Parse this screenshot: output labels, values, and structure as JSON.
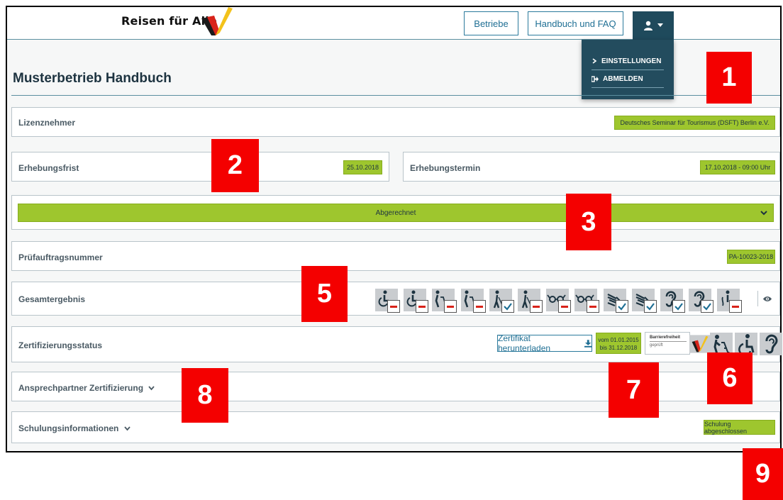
{
  "brand": {
    "name": "Reisen für Alle"
  },
  "nav": {
    "betriebe": "Betriebe",
    "handbuch": "Handbuch und FAQ"
  },
  "user_menu": {
    "items": [
      {
        "label": "EINSTELLUNGEN",
        "icon": "chevron-right-icon"
      },
      {
        "label": "ABMELDEN",
        "icon": "sign-out-icon"
      }
    ]
  },
  "page": {
    "title": "Musterbetrieb Handbuch"
  },
  "lizenznehmer": {
    "label": "Lizenznehmer",
    "value": "Deutsches Seminar für Tourismus (DSFT) Berlin e.V."
  },
  "erhebungsfrist": {
    "label": "Erhebungsfrist",
    "value": "25.10.2018"
  },
  "erhebungstermin": {
    "label": "Erhebungstermin",
    "value": "17.10.2018 - 09:00 Uhr"
  },
  "status": {
    "label": "Abgerechnet"
  },
  "pruefauftrag": {
    "label": "Prüfauftragsnummer",
    "value": "PA-10023-2018"
  },
  "gesamtergebnis": {
    "label": "Gesamtergebnis",
    "icons": [
      {
        "name": "wheelchair-icon",
        "result": "minus"
      },
      {
        "name": "wheelchair-icon",
        "result": "minus"
      },
      {
        "name": "walker-icon",
        "result": "minus"
      },
      {
        "name": "walker-icon",
        "result": "minus"
      },
      {
        "name": "cane-icon",
        "result": "check"
      },
      {
        "name": "cane-icon",
        "result": "minus"
      },
      {
        "name": "glasses-icon",
        "result": "minus"
      },
      {
        "name": "glasses-icon",
        "result": "minus"
      },
      {
        "name": "sign-language-icon",
        "result": "check"
      },
      {
        "name": "sign-language-icon",
        "result": "check"
      },
      {
        "name": "hearing-icon",
        "result": "check"
      },
      {
        "name": "hearing-icon",
        "result": "check"
      },
      {
        "name": "cognitive-icon",
        "result": "minus"
      }
    ]
  },
  "zertifizierung": {
    "label": "Zertifizierungsstatus",
    "download": "Zertifikat herunterladen",
    "date_from": "vom 01.01.2015",
    "date_to": "bis 31.12.2018",
    "seal_line1": "Barrierefreiheit",
    "seal_line2": "geprüft"
  },
  "ansprechpartner": {
    "label": "Ansprechpartner Zertifizierung"
  },
  "schulung": {
    "label": "Schulungsinformationen",
    "value": "Schulung abgeschlossen"
  },
  "markers": [
    "1",
    "2",
    "3",
    "5",
    "6",
    "7",
    "8",
    "9"
  ],
  "colors": {
    "accent_green": "#9ec62e",
    "nav_dark": "#1f4a5c",
    "link_blue": "#1f6f94",
    "marker_red": "#f40000"
  }
}
